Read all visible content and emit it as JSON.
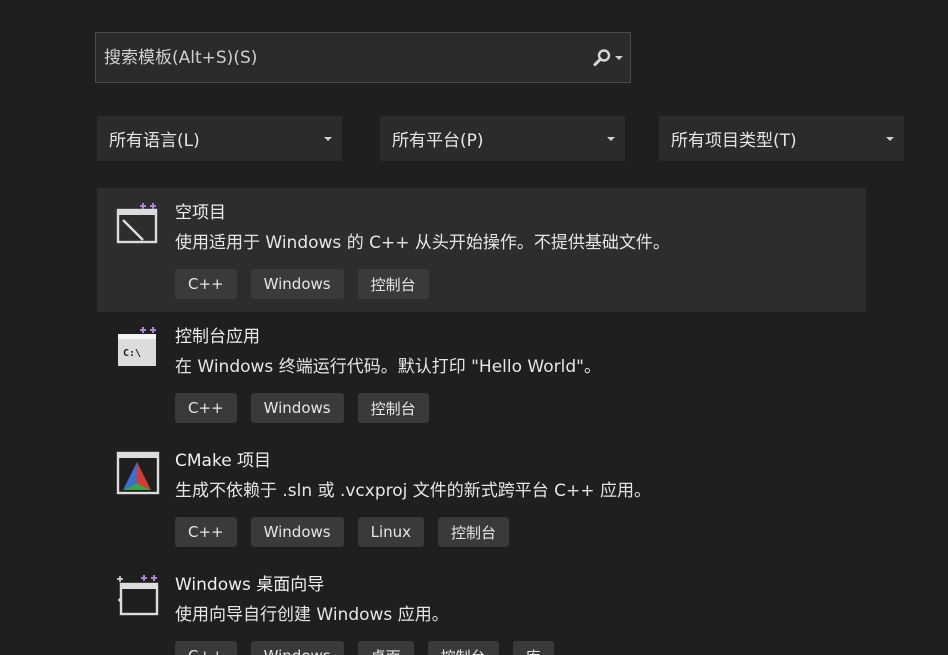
{
  "search": {
    "placeholder": "搜索模板(Alt+S)(S)",
    "value": ""
  },
  "filters": {
    "language": "所有语言(L)",
    "platform": "所有平台(P)",
    "project_type": "所有项目类型(T)"
  },
  "templates": [
    {
      "title": "空项目",
      "description": "使用适用于 Windows 的 C++ 从头开始操作。不提供基础文件。",
      "tags": [
        "C++",
        "Windows",
        "控制台"
      ]
    },
    {
      "title": "控制台应用",
      "description": "在 Windows 终端运行代码。默认打印 \"Hello World\"。",
      "tags": [
        "C++",
        "Windows",
        "控制台"
      ]
    },
    {
      "title": "CMake 项目",
      "description": "生成不依赖于 .sln 或 .vcxproj 文件的新式跨平台 C++ 应用。",
      "tags": [
        "C++",
        "Windows",
        "Linux",
        "控制台"
      ]
    },
    {
      "title": "Windows 桌面向导",
      "description": "使用向导自行创建 Windows 应用。",
      "tags": [
        "C++",
        "Windows",
        "桌面",
        "控制台",
        "库"
      ]
    }
  ],
  "icon_label_console": "C:\\",
  "colors": {
    "accent_purple": "#b180d7",
    "background": "#1f1f1f",
    "selected": "#2d2d2d",
    "tag_bg": "#3a3a3a"
  }
}
